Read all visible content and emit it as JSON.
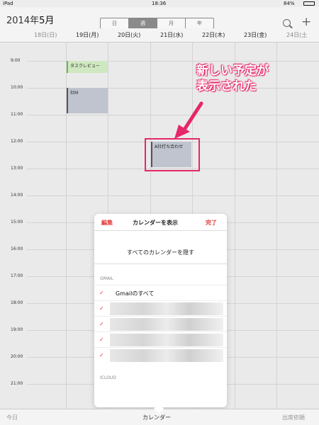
{
  "status": {
    "device": "iPad",
    "time": "18:36",
    "battery": "84%"
  },
  "header": {
    "year": "2014年",
    "month": "5月",
    "segments": [
      {
        "label": "日"
      },
      {
        "label": "週"
      },
      {
        "label": "月"
      },
      {
        "label": "年"
      }
    ],
    "active_segment": "週"
  },
  "days": [
    "18日(日)",
    "19日(月)",
    "20日(火)",
    "21日(水)",
    "22日(木)",
    "23日(金)",
    "24日(土"
  ],
  "times": [
    "9:00",
    "10:00",
    "11:00",
    "12:00",
    "13:00",
    "14:00",
    "15:00",
    "16:00",
    "17:00",
    "18:00",
    "19:00",
    "20:00",
    "21:00"
  ],
  "events": [
    {
      "title": "タスクレビュー"
    },
    {
      "title": "社M"
    },
    {
      "title": "A社打ち合わせ"
    }
  ],
  "annotation": {
    "line1": "新しい予定が",
    "line2": "表示された"
  },
  "popover": {
    "edit": "編集",
    "title": "カレンダーを表示",
    "done": "完了",
    "hide_all": "すべてのカレンダーを隠す",
    "section_gmail": "GMAIL",
    "gmail_all": "Gmailのすべて",
    "section_icloud": "ICLOUD"
  },
  "bottom": {
    "today": "今日",
    "calendars": "カレンダー",
    "inbox": "出席依頼"
  },
  "colors": {
    "accent_red": "#e23a3a",
    "annotation_pink": "#e6276a",
    "event_green": "#cfe8c2",
    "event_grey": "#bfc4cf"
  }
}
